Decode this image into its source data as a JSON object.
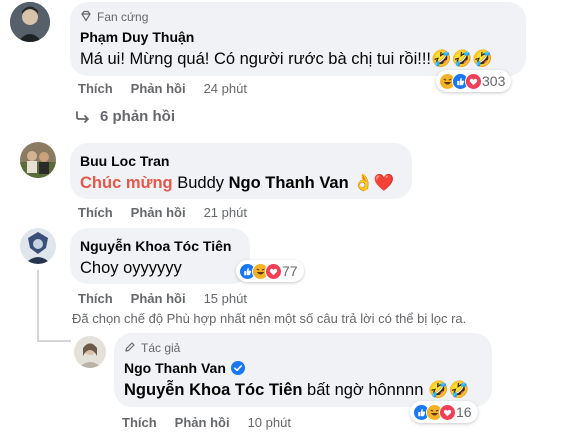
{
  "comments": [
    {
      "badge": "Fan cứng",
      "author": "Phạm Duy Thuận",
      "text": "Má ui! Mừng quá! Có người rước bà chị tui rồi!!!🤣🤣🤣",
      "like": "Thích",
      "reply": "Phản hồi",
      "time": "24 phút",
      "reaction_count": "303",
      "reaction_icons": [
        "haha-icon",
        "like-icon",
        "love-icon"
      ]
    },
    {
      "author": "Buu Loc Tran",
      "text_highlight": "Chúc mừng",
      "text_middle": " Buddy ",
      "text_mention": "Ngo Thanh Van",
      "text_emoji": " 👌❤️",
      "like": "Thích",
      "reply": "Phản hồi",
      "time": "21 phút"
    },
    {
      "author": "Nguyễn Khoa Tóc Tiên",
      "text": "Choy oyyyyyy",
      "like": "Thích",
      "reply": "Phản hồi",
      "time": "15 phút",
      "reaction_count": "77",
      "reaction_icons": [
        "like-icon",
        "haha-icon",
        "love-icon"
      ]
    }
  ],
  "replies_link": "6 phản hồi",
  "filter_notice": "Đã chọn chế độ Phù hợp nhất nên một số câu trả lời có thể bị lọc ra.",
  "reply_comment": {
    "badge": "Tác giả",
    "author": "Ngo Thanh Van",
    "text_mention": "Nguyễn Khoa Tóc Tiên",
    "text_rest": " bất ngờ hônnnn 🤣🤣",
    "like": "Thích",
    "reply": "Phản hồi",
    "time": "10 phút",
    "reaction_count": "16",
    "reaction_icons": [
      "like-icon",
      "haha-icon",
      "love-icon"
    ]
  },
  "colors": {
    "bubble": "#f0f2f5",
    "secondary_text": "#65676b",
    "like_blue": "#1877f2",
    "love_red": "#f33e58",
    "haha_yellow": "#f7b125",
    "highlight_red": "#e4574a",
    "verified_blue": "#1877f2"
  }
}
